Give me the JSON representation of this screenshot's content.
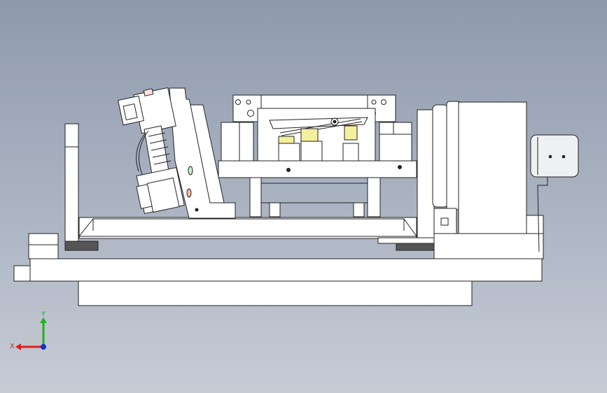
{
  "view": {
    "type": "cad-3d-viewport",
    "background_top": "#8e9aac",
    "background_bottom": "#c6ccd6",
    "part_fill": "#ffffff",
    "line_color": "#222222",
    "accent_yellow": "#f4ef9c",
    "dark_pad": "#555555"
  },
  "triad": {
    "x_label": "X",
    "y_label": "Y",
    "x_color": "#e02020",
    "y_color": "#20b020",
    "z_color": "#1030d0"
  }
}
